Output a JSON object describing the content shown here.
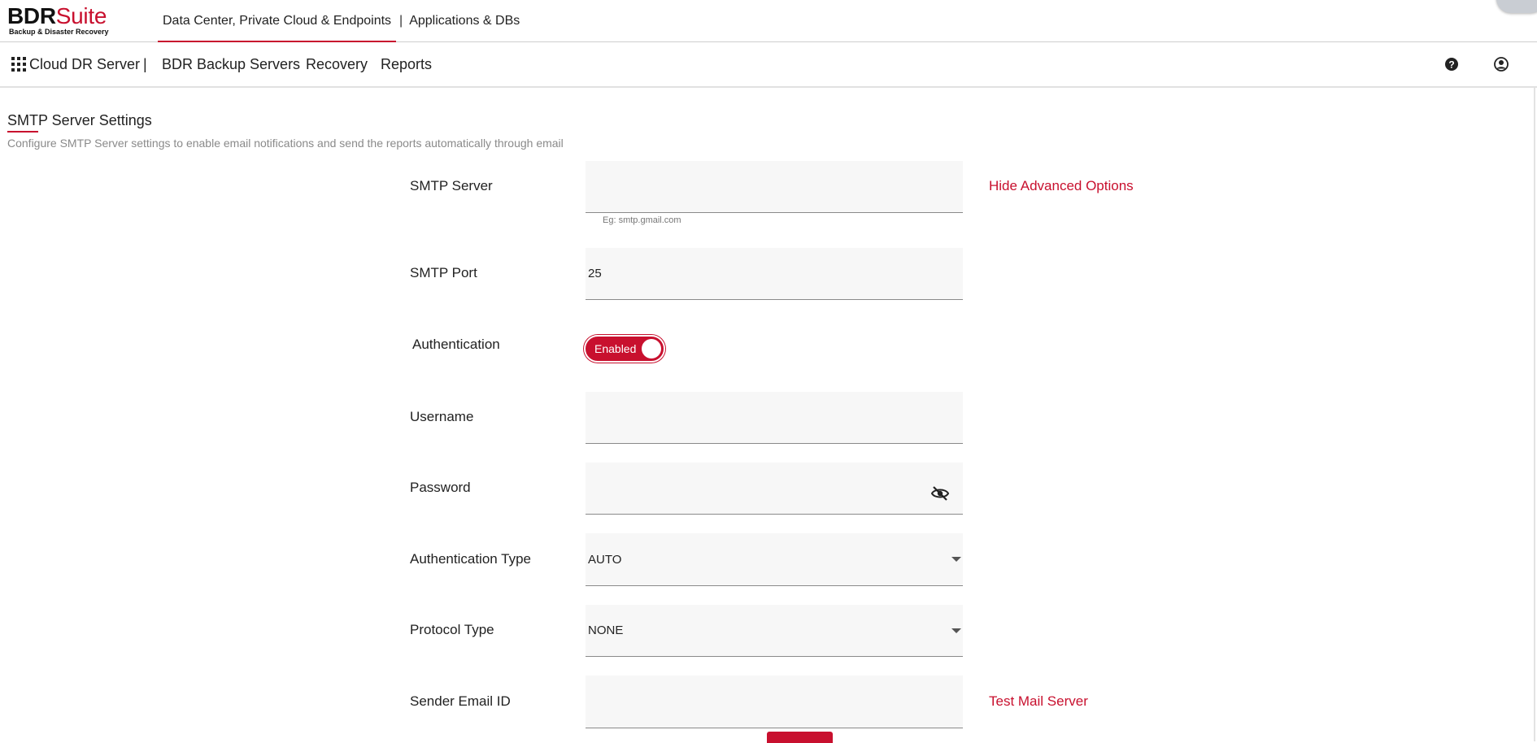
{
  "brand": {
    "name_bold": "BDR",
    "name_accent": "Suite",
    "tagline": "Backup & Disaster Recovery",
    "accent_color": "#c8102e"
  },
  "topnav": {
    "tab_active": "Data Center, Private Cloud & Endpoints",
    "separator": "|",
    "tab_other": "Applications & DBs"
  },
  "subnav": {
    "grid_icon": "grid-icon",
    "cloud_dr": "Cloud DR Server",
    "separator": "|",
    "items": [
      "BDR Backup Servers",
      "Recovery",
      "Reports"
    ],
    "help_icon": "help-icon",
    "user_icon": "user-icon"
  },
  "page": {
    "title": "SMTP Server Settings",
    "description": "Configure SMTP Server settings to enable email notifications and send the reports automatically through email"
  },
  "form": {
    "smtp_server": {
      "label": "SMTP Server",
      "value": "",
      "hint": "Eg: smtp.gmail.com"
    },
    "advanced_link": "Hide Advanced Options",
    "smtp_port": {
      "label": "SMTP Port",
      "value": "25"
    },
    "authentication": {
      "label": "Authentication",
      "toggle_text": "Enabled",
      "enabled": true
    },
    "username": {
      "label": "Username",
      "value": ""
    },
    "password": {
      "label": "Password",
      "value": "",
      "icon": "eye-slash-icon"
    },
    "auth_type": {
      "label": "Authentication Type",
      "value": "AUTO"
    },
    "protocol_type": {
      "label": "Protocol Type",
      "value": "NONE"
    },
    "sender_email": {
      "label": "Sender Email ID",
      "value": ""
    },
    "test_link": "Test Mail Server"
  }
}
